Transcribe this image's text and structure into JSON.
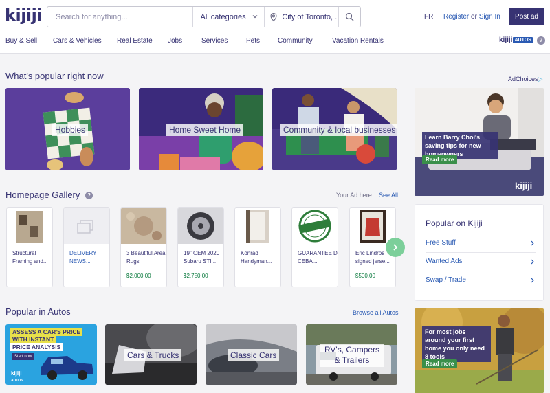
{
  "header": {
    "logo": "kijiji",
    "search_placeholder": "Search for anything...",
    "category": "All categories",
    "location": "City of Toronto, ...",
    "lang": "FR",
    "register": "Register",
    "or": " or ",
    "signin": "Sign In",
    "post_ad": "Post ad"
  },
  "nav": [
    "Buy & Sell",
    "Cars & Vehicles",
    "Real Estate",
    "Jobs",
    "Services",
    "Pets",
    "Community",
    "Vacation Rentals"
  ],
  "autos_logo": {
    "word": "kijiji",
    "badge": "AUTOS"
  },
  "popular": {
    "title": "What's popular right now",
    "tiles": [
      {
        "label": "Hobbies",
        "icon": "chessboard-icon"
      },
      {
        "label": "Home Sweet Home",
        "icon": "person-icon"
      },
      {
        "label": "Community & local businesses",
        "icon": "people-icon"
      }
    ]
  },
  "adchoices": "AdChoices",
  "right_ad": {
    "caption": "Learn Barry Choi's saving tips for new homeowners",
    "cta": "Read more",
    "brand": "kijiji"
  },
  "gallery": {
    "title": "Homepage Gallery",
    "your_ad": "Your Ad here",
    "see_all": "See All",
    "items": [
      {
        "title": "Structural Framing and...",
        "price": "",
        "blue": false
      },
      {
        "title": "DELIVERY NEWS...",
        "price": "",
        "blue": true
      },
      {
        "title": "3 Beautiful Area Rugs",
        "price": "$2,000.00",
        "blue": false
      },
      {
        "title": "19\" OEM 2020 Subaru STI...",
        "price": "$2,750.00",
        "blue": false
      },
      {
        "title": "Konrad Handyman...",
        "price": "",
        "blue": false
      },
      {
        "title": "GUARANTEE D CEBA...",
        "price": "",
        "blue": false
      },
      {
        "title": "Eric Lindros signed jerse...",
        "price": "$500.00",
        "blue": false
      }
    ]
  },
  "popular_on": {
    "title": "Popular on Kijiji",
    "items": [
      "Free Stuff",
      "Wanted Ads",
      "Swap / Trade"
    ]
  },
  "autos": {
    "title": "Popular in Autos",
    "browse": "Browse all Autos",
    "promo": {
      "line1": "ASSESS A CAR'S PRICE",
      "line2": "WITH INSTANT",
      "line3": "PRICE ANALYSIS",
      "cta": "Start now",
      "brand": "kijiji",
      "badge": "AUTOS"
    },
    "tiles": [
      "Cars & Trucks",
      "Classic Cars",
      "RV's, Campers & Trailers"
    ]
  },
  "bottom_ad": {
    "caption": "For most jobs around your first home you only need 8 tools",
    "cta": "Read more"
  }
}
